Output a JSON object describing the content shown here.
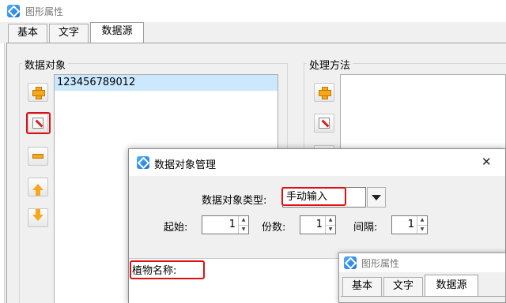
{
  "main_window": {
    "title": "图形属性",
    "tabs": [
      "基本",
      "文字",
      "数据源"
    ],
    "active_tab_index": 2,
    "data_objects_group": "数据对象",
    "processing_group": "处理方法",
    "data_items": [
      "123456789012"
    ]
  },
  "modal": {
    "title": "数据对象管理",
    "close_glyph": "✕",
    "type_label": "数据对象类型:",
    "type_value": "手动输入",
    "start_label": "起始:",
    "start_value": "1",
    "copies_label": "份数:",
    "copies_value": "1",
    "interval_label": "间隔:",
    "interval_value": "1",
    "text_content": "植物名称:"
  },
  "mini_window": {
    "title": "图形属性",
    "tabs": [
      "基本",
      "文字",
      "数据源"
    ],
    "active_tab_index": 2
  },
  "colors": {
    "highlight": "#e01010",
    "selection": "#cce8ff",
    "button_icon": "#f6a81c"
  }
}
